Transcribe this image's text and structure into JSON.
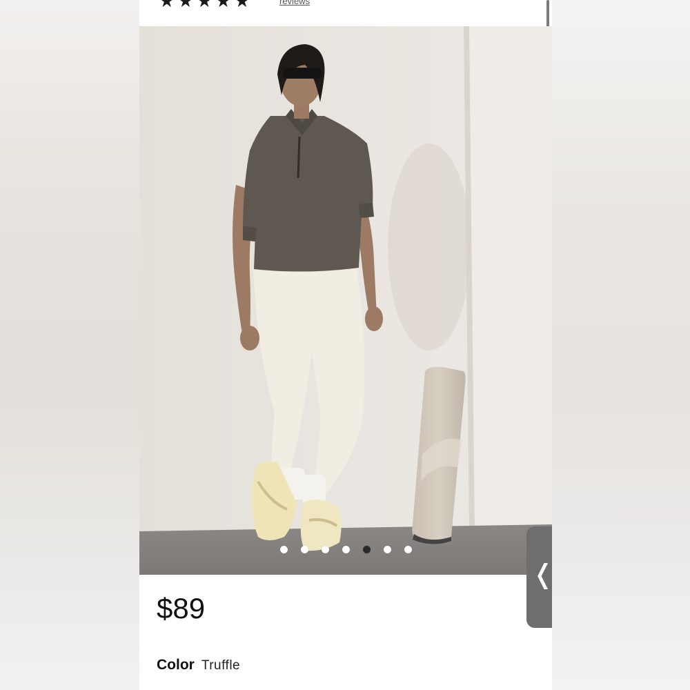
{
  "product": {
    "rating_stars": "★★★★★",
    "reviews_link": "reviews",
    "price": "$89",
    "color_label": "Color",
    "color_value": "Truffle"
  },
  "gallery": {
    "image_alt": "Model wearing a dark zip pullover and cream leggings beside a rolled yoga mat",
    "dot_count": 7,
    "active_index": 4
  },
  "side_tab": {
    "chevron": "❬"
  },
  "colors": {
    "price_text": "#111111",
    "active_dot": "#2b2b2b",
    "inactive_dot": "#ffffff",
    "side_tab": "#6e6e6e"
  }
}
